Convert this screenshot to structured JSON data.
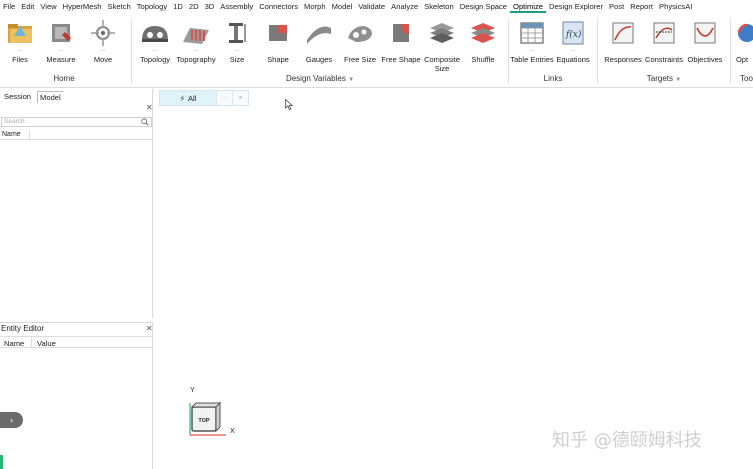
{
  "menubar": {
    "items": [
      "File",
      "Edit",
      "View",
      "HyperMesh",
      "Sketch",
      "Topology",
      "1D",
      "2D",
      "3D",
      "Assembly",
      "Connectors",
      "Morph",
      "Model",
      "Validate",
      "Analyze",
      "Skeleton",
      "Design Space",
      "Optimize",
      "Design Explorer",
      "Post",
      "Report",
      "PhysicsAI"
    ],
    "active_index": 17
  },
  "ribbon": {
    "home": {
      "label": "Home",
      "buttons": [
        {
          "label": "Files"
        },
        {
          "label": "Measure"
        },
        {
          "label": "Move"
        }
      ]
    },
    "design_variables": {
      "label": "Design Variables",
      "buttons": [
        {
          "label": "Topology",
          "dots": "..."
        },
        {
          "label": "Topography",
          "dots": "..."
        },
        {
          "label": "Size",
          "dots": "..."
        },
        {
          "label": "Shape",
          "dots": ""
        },
        {
          "label": "Gauges",
          "dots": ""
        },
        {
          "label": "Free Size",
          "dots": ""
        },
        {
          "label": "Free Shape",
          "dots": ""
        },
        {
          "label": "Composite Size",
          "dots": ""
        },
        {
          "label": "Shuffle",
          "dots": ""
        }
      ]
    },
    "links": {
      "label": "Links",
      "buttons": [
        {
          "label": "Table Entries",
          "dots": "..."
        },
        {
          "label": "Equations",
          "dots": "..."
        }
      ]
    },
    "targets": {
      "label": "Targets",
      "buttons": [
        {
          "label": "Responses"
        },
        {
          "label": "Constraints"
        },
        {
          "label": "Objectives"
        }
      ]
    },
    "tools": {
      "label": "Too",
      "buttons": [
        {
          "label": "Opt"
        }
      ]
    }
  },
  "browser": {
    "tabs": [
      "Session",
      "Model"
    ],
    "active_tab": "Model",
    "search_placeholder": "Search",
    "columns": [
      "Name"
    ]
  },
  "entity_editor": {
    "title": "Entity Editor",
    "columns": [
      "Name",
      "Value"
    ]
  },
  "viewport": {
    "filter_label": "All",
    "cube_label": "TOP",
    "axis_y": "Y",
    "axis_x": "X"
  },
  "watermark": "知乎 @德颐姆科技",
  "colors": {
    "accent": "#1a9e7f",
    "green_bar": "#2bb673"
  }
}
